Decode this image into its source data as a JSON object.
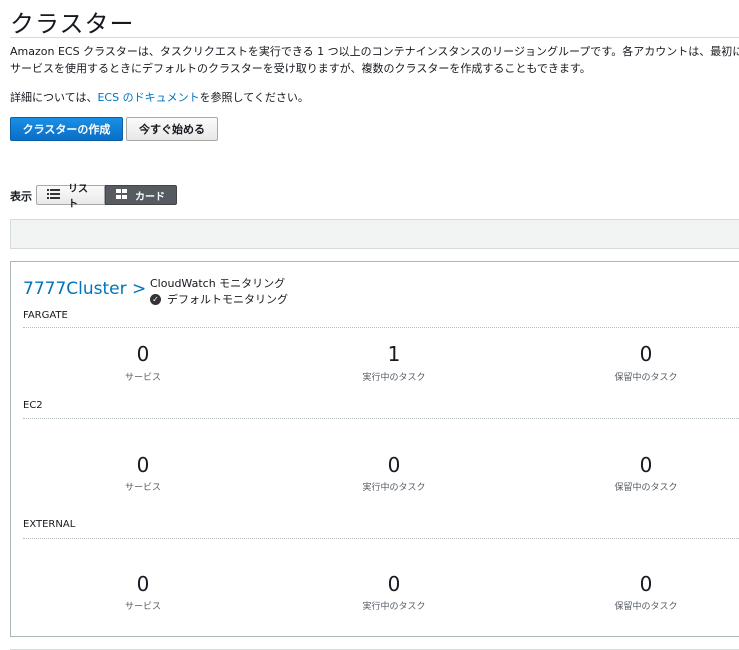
{
  "page": {
    "title": "クラスター",
    "description": "Amazon ECS クラスターは、タスクリクエストを実行できる 1 つ以上のコンテナインスタンスのリージョングループです。各アカウントは、最初にサービスを使用するときにデフォルトのクラスターを受け取りますが、複数のクラスターを作成することもできます。",
    "details_prefix": "詳細については、",
    "details_link": "ECS のドキュメント",
    "details_suffix": "を参照してください。"
  },
  "buttons": {
    "create_cluster": "クラスターの作成",
    "get_started": "今すぐ始める"
  },
  "view": {
    "label": "表示",
    "list": "リスト",
    "card": "カード",
    "selected": "card"
  },
  "cluster": {
    "name": "7777Cluster >",
    "cloudwatch_title": "CloudWatch モニタリング",
    "cloudwatch_status": "デフォルトモニタリング",
    "sections": [
      {
        "label": "FARGATE",
        "stats": [
          {
            "value": "0",
            "caption": "サービス"
          },
          {
            "value": "1",
            "caption": "実行中のタスク"
          },
          {
            "value": "0",
            "caption": "保留中のタスク"
          }
        ]
      },
      {
        "label": "EC2",
        "stats": [
          {
            "value": "0",
            "caption": "サービス"
          },
          {
            "value": "0",
            "caption": "実行中のタスク"
          },
          {
            "value": "0",
            "caption": "保留中のタスク"
          }
        ]
      },
      {
        "label": "EXTERNAL",
        "stats": [
          {
            "value": "0",
            "caption": "サービス"
          },
          {
            "value": "0",
            "caption": "実行中のタスク"
          },
          {
            "value": "0",
            "caption": "保留中のタスク"
          }
        ]
      }
    ]
  },
  "colors": {
    "primary_button": "#0f7ed6",
    "link": "#0073bb",
    "selected_toggle": "#555b61"
  }
}
